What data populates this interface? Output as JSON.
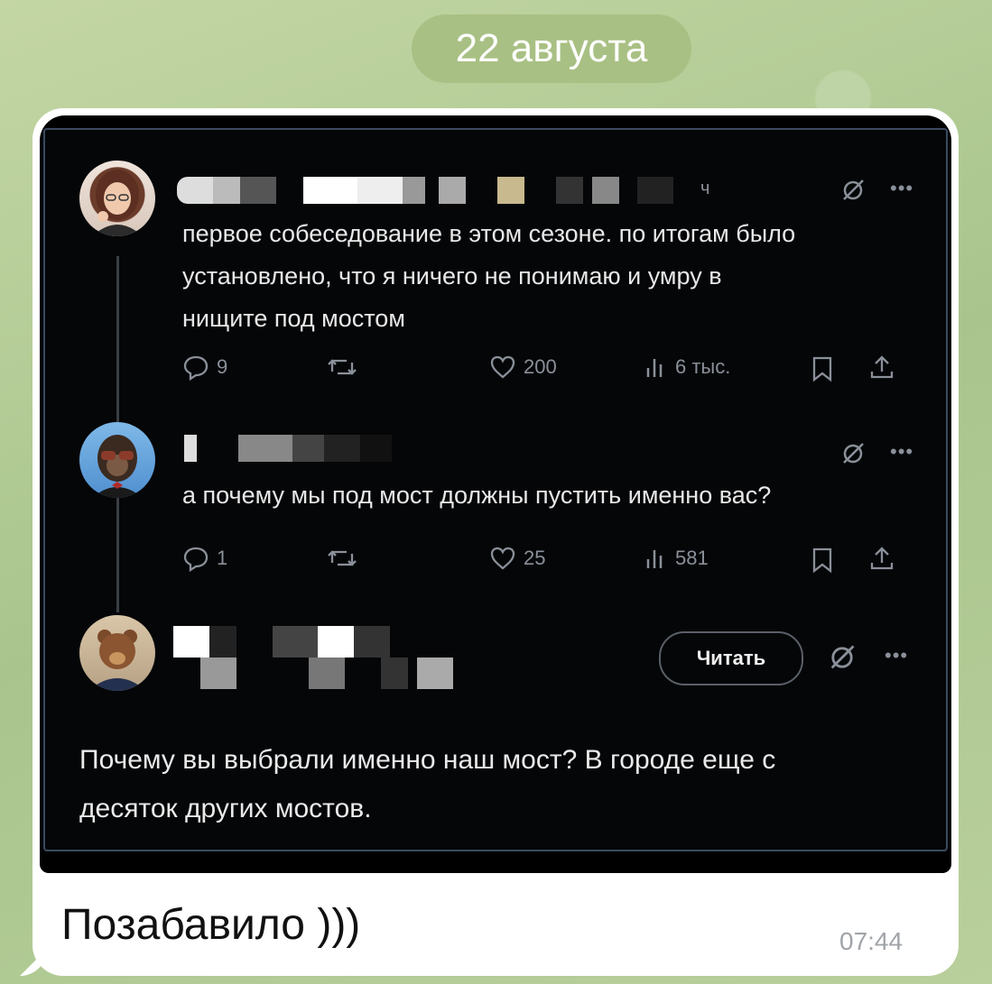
{
  "date_separator": "22 августа",
  "tweets": [
    {
      "time": "ч",
      "text_lines": [
        "первое собеседование в этом сезоне. по итогам было",
        "установлено, что я ничего не понимаю и умру в",
        "нищите под мостом"
      ],
      "replies": "9",
      "likes": "200",
      "views": "6 тыс."
    },
    {
      "text_lines": [
        "а почему мы под мост должны пустить именно вас?"
      ],
      "replies": "1",
      "likes": "25",
      "views": "581"
    },
    {
      "read_button": "Читать",
      "text_lines": [
        "Почему вы выбрали именно наш мост? В городе еще с",
        "десяток других мостов."
      ]
    }
  ],
  "message": {
    "caption": "Позабавило )))",
    "time": "07:44"
  },
  "icons": [
    "reply-icon",
    "retweet-icon",
    "like-icon",
    "views-icon",
    "bookmark-icon",
    "share-icon",
    "grok-icon",
    "more-icon"
  ],
  "colors": {
    "background": "#b7cf9a",
    "date_pill": "#a9c084",
    "bubble": "#ffffff",
    "tweet_bg": "#000000",
    "muted": "#8a9099"
  }
}
